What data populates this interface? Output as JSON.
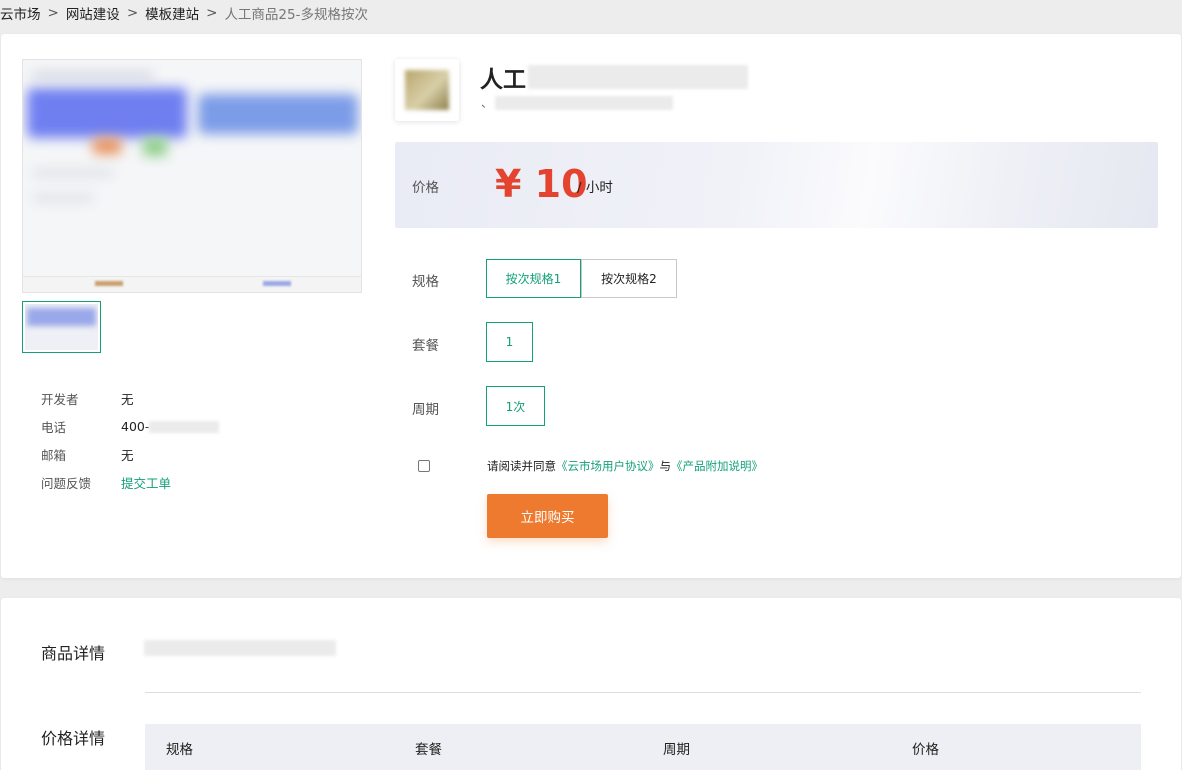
{
  "breadcrumb": {
    "items": [
      "云市场",
      "网站建设",
      "模板建站"
    ],
    "separator": ">",
    "current": "人工商品25-多规格按次"
  },
  "product": {
    "title_visible": "人工",
    "subtitle_visible": "、"
  },
  "developer": {
    "rows": [
      {
        "label": "开发者",
        "value": "无"
      },
      {
        "label": "电话",
        "value": "400-"
      },
      {
        "label": "邮箱",
        "value": "无"
      },
      {
        "label": "问题反馈",
        "value": "提交工单"
      }
    ]
  },
  "price": {
    "label": "价格",
    "amount": "¥ 10",
    "unit": "/ 小时"
  },
  "options": {
    "spec": {
      "label": "规格",
      "items": [
        "按次规格1",
        "按次规格2"
      ],
      "selected": "按次规格1"
    },
    "package": {
      "label": "套餐",
      "items": [
        "1"
      ],
      "selected": "1"
    },
    "period": {
      "label": "周期",
      "items": [
        "1次"
      ],
      "selected": "1次"
    }
  },
  "agreement": {
    "prefix": "请阅读并同意",
    "link1": "《云市场用户协议》",
    "middle": "与",
    "link2": "《产品附加说明》",
    "checked": false
  },
  "buy_button": "立即购买",
  "detail": {
    "product_detail_title": "商品详情",
    "price_detail_title": "价格详情",
    "table_headers": [
      "规格",
      "套餐",
      "周期",
      "价格"
    ]
  },
  "colors": {
    "accent": "#14a079",
    "price": "#e4432f",
    "buy": "#ee7a2f"
  }
}
